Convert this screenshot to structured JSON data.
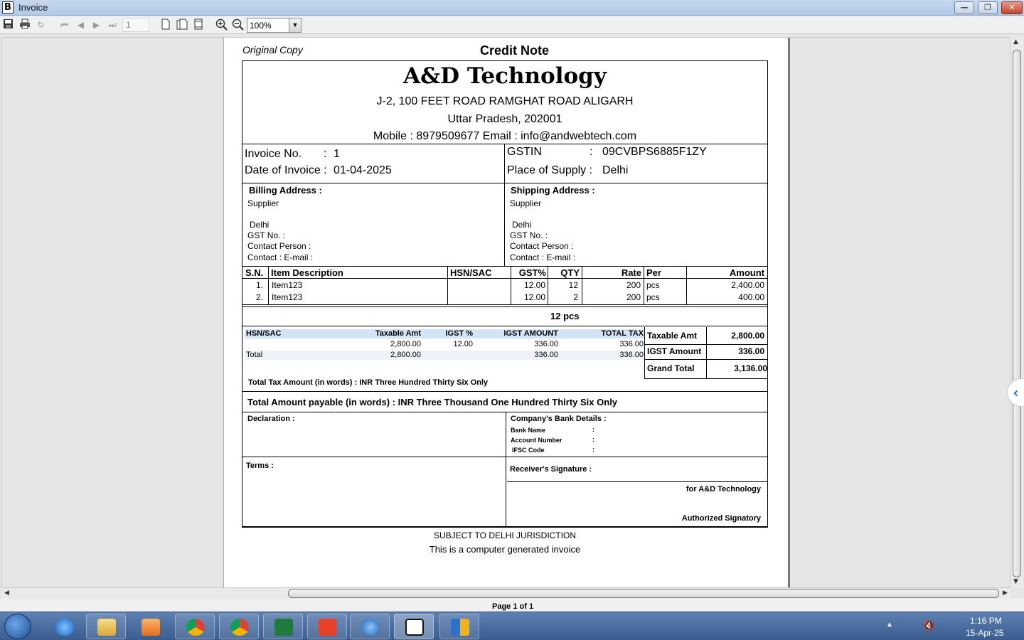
{
  "window": {
    "title": "Invoice",
    "minimize": "—",
    "restore": "❐",
    "close": "✕"
  },
  "toolbar": {
    "page_value": "1",
    "zoom_value": "100%",
    "icons": [
      "save-icon",
      "print-icon",
      "refresh-icon",
      "first-page-icon",
      "prev-page-icon",
      "next-page-icon",
      "last-page-icon",
      "single-page-icon",
      "two-page-icon",
      "page-setup-icon",
      "zoom-in-icon",
      "zoom-out-icon",
      "dropdown-icon"
    ]
  },
  "invoice": {
    "copy_label": "Original Copy",
    "doc_title": "Credit Note",
    "company": {
      "name": "A&D Technology",
      "address1": "J-2, 100 FEET ROAD RAMGHAT ROAD ALIGARH",
      "address2": "Uttar Pradesh, 202001",
      "contact": "Mobile : 8979509677  Email : info@andwebtech.com"
    },
    "meta": {
      "invoice_no_label": "Invoice No.",
      "invoice_no": "1",
      "date_label": "Date of Invoice :",
      "date": "01-04-2025",
      "gstin_label": "GSTIN",
      "gstin": "09CVBPS6885F1ZY",
      "supply_label": "Place of Supply :",
      "supply": "Delhi",
      "colon": ":"
    },
    "billing": {
      "heading": "Billing Address :",
      "name": "Supplier",
      "city": "Delhi",
      "gst": "GST No. :",
      "person": "Contact Person :",
      "contact": "Contact :  E-mail :"
    },
    "shipping": {
      "heading": "Shipping Address :",
      "name": "Supplier",
      "city": "Delhi",
      "gst": "GST No. :",
      "person": "Contact Person :",
      "contact": "Contact :  E-mail :"
    },
    "items_header": {
      "sn": "S.N.",
      "desc": "Item Description",
      "hsn": "HSN/SAC",
      "gst": "GST%",
      "qty": "QTY",
      "rate": "Rate",
      "per": "Per",
      "amount": "Amount"
    },
    "items": [
      {
        "sn": "1.",
        "desc": "Item123",
        "hsn": "",
        "gst": "12.00",
        "qty": "12",
        "rate": "200",
        "per": "pcs",
        "amount": "2,400.00"
      },
      {
        "sn": "2.",
        "desc": "Item123",
        "hsn": "",
        "gst": "12.00",
        "qty": "2",
        "rate": "200",
        "per": "pcs",
        "amount": "400.00"
      }
    ],
    "total_qty": "12 pcs",
    "tax_table": {
      "headers": {
        "hsn": "HSN/SAC",
        "taxable": "Taxable Amt",
        "igst_pct": "IGST %",
        "igst_amt": "IGST AMOUNT",
        "total_tax": "TOTAL TAX"
      },
      "row": {
        "hsn": "",
        "taxable": "2,800.00",
        "igst_pct": "12.00",
        "igst_amt": "336.00",
        "total_tax": "336.00"
      },
      "total": {
        "label": "Total",
        "taxable": "2,800.00",
        "igst_amt": "336.00",
        "total_tax": "336.00"
      }
    },
    "summary": {
      "taxable_label": "Taxable Amt",
      "taxable": "2,800.00",
      "igst_label": "IGST Amount",
      "igst": "336.00",
      "grand_label": "Grand Total",
      "grand": "3,136.00"
    },
    "tax_words": "Total Tax Amount (in words) : INR Three Hundred Thirty Six Only",
    "amount_words": "Total Amount payable (in words) : INR Three Thousand One Hundred Thirty Six Only",
    "declaration": "Declaration :",
    "bank": {
      "heading": "Company's Bank Details :",
      "bank_name": "Bank Name",
      "account": "Account Number",
      "ifsc": "IFSC Code",
      "colon": ":"
    },
    "terms": "Terms :",
    "receiver": "Receiver's Signature :",
    "for_company": "for  A&D Technology",
    "signatory": "Authorized Signatory",
    "jurisdiction": "SUBJECT TO DELHI JURISDICTION",
    "generated": "This is a computer generated invoice"
  },
  "status": {
    "page": "Page 1 of 1"
  },
  "taskbar": {
    "time": "1:16 PM",
    "date": "15-Apr-25",
    "apps": [
      "ie-icon",
      "file-explorer-icon",
      "media-player-icon",
      "chrome-icon",
      "chrome-profile-icon",
      "excel-icon",
      "anydesk-icon",
      "remote-desktop-icon",
      "busy-app-icon",
      "app-window-icon"
    ]
  }
}
